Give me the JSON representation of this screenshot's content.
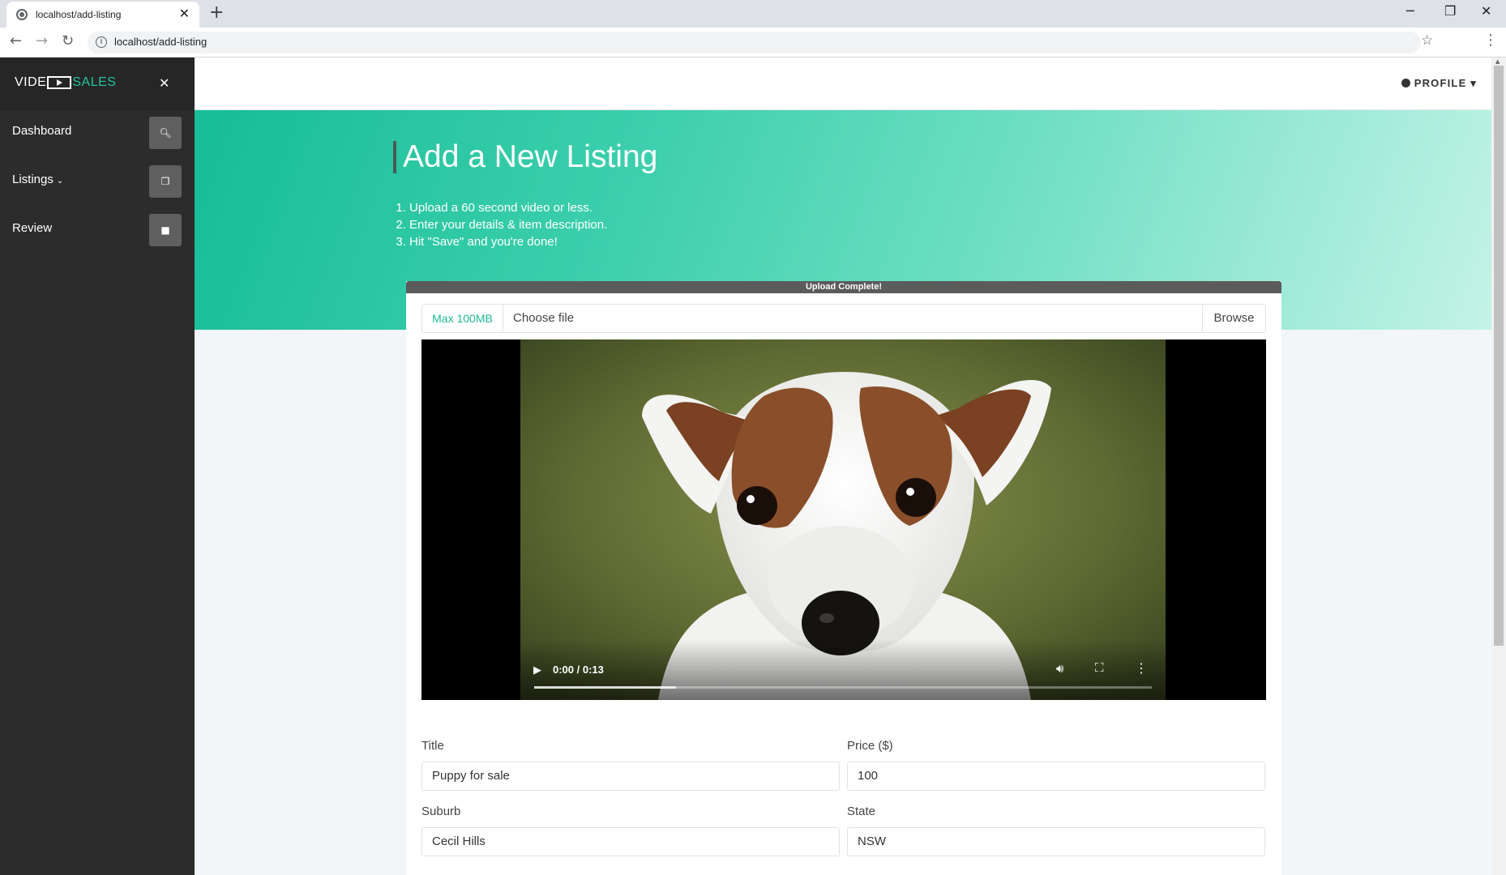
{
  "browser": {
    "tab_title": "localhost/add-listing",
    "url": "localhost/add-listing",
    "new_tab": "+",
    "tab_close": "✕"
  },
  "sidebar": {
    "logo_left": "VIDE",
    "logo_right": "SALES",
    "items": [
      {
        "label": "Dashboard",
        "icon": "search-icon"
      },
      {
        "label": "Listings",
        "icon": "copy-icon",
        "caret": "⌄"
      },
      {
        "label": "Review",
        "icon": "note-icon"
      }
    ]
  },
  "topnav": {
    "profile_label": "PROFILE"
  },
  "hero": {
    "title": "Add a New Listing",
    "steps": [
      "Upload a 60 second video or less.",
      "Enter your details & item description.",
      "Hit \"Save\" and you're done!"
    ]
  },
  "upload": {
    "progress_text": "Upload Complete!",
    "progress_value": 1.0,
    "max_label": "Max 100MB",
    "file_placeholder": "Choose file",
    "browse_label": "Browse"
  },
  "video": {
    "time": "0:00 / 0:13",
    "buffered_fraction": 0.23
  },
  "form": {
    "title_label": "Title",
    "title_value": "Puppy for sale",
    "price_label": "Price ($)",
    "price_value": "100",
    "suburb_label": "Suburb",
    "suburb_value": "Cecil Hills",
    "state_label": "State",
    "state_value": "NSW"
  },
  "colors": {
    "accent": "#1fc5a0",
    "sidebar": "#2c2c2c",
    "hero_start": "#16bd97",
    "hero_end": "#c3f3e6"
  }
}
